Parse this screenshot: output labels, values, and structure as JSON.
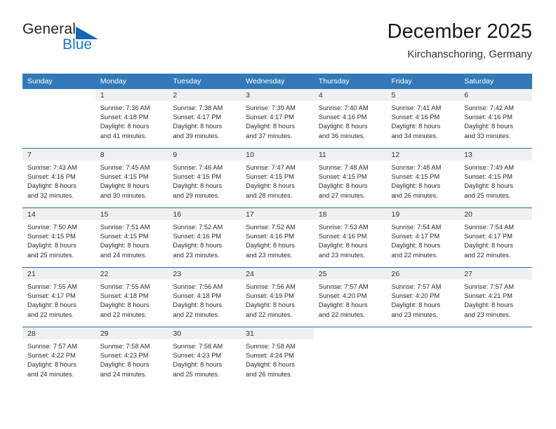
{
  "brand": {
    "name_part1": "General",
    "name_part2": "Blue",
    "triangle_color": "#1666b0",
    "blue_color": "#1779ce"
  },
  "header": {
    "title": "December 2025",
    "subtitle": "Kirchanschoring, Germany"
  },
  "theme": {
    "header_bg": "#3379b8",
    "daynum_band": "#f0f0f0",
    "row_divider": "#2c6aa8"
  },
  "weekday_headers": [
    "Sunday",
    "Monday",
    "Tuesday",
    "Wednesday",
    "Thursday",
    "Friday",
    "Saturday"
  ],
  "weeks": [
    [
      {
        "day": "",
        "lines": [
          "",
          "",
          "",
          ""
        ]
      },
      {
        "day": "1",
        "lines": [
          "Sunrise: 7:36 AM",
          "Sunset: 4:18 PM",
          "Daylight: 8 hours",
          "and 41 minutes."
        ]
      },
      {
        "day": "2",
        "lines": [
          "Sunrise: 7:38 AM",
          "Sunset: 4:17 PM",
          "Daylight: 8 hours",
          "and 39 minutes."
        ]
      },
      {
        "day": "3",
        "lines": [
          "Sunrise: 7:39 AM",
          "Sunset: 4:17 PM",
          "Daylight: 8 hours",
          "and 37 minutes."
        ]
      },
      {
        "day": "4",
        "lines": [
          "Sunrise: 7:40 AM",
          "Sunset: 4:16 PM",
          "Daylight: 8 hours",
          "and 36 minutes."
        ]
      },
      {
        "day": "5",
        "lines": [
          "Sunrise: 7:41 AM",
          "Sunset: 4:16 PM",
          "Daylight: 8 hours",
          "and 34 minutes."
        ]
      },
      {
        "day": "6",
        "lines": [
          "Sunrise: 7:42 AM",
          "Sunset: 4:16 PM",
          "Daylight: 8 hours",
          "and 33 minutes."
        ]
      }
    ],
    [
      {
        "day": "7",
        "lines": [
          "Sunrise: 7:43 AM",
          "Sunset: 4:16 PM",
          "Daylight: 8 hours",
          "and 32 minutes."
        ]
      },
      {
        "day": "8",
        "lines": [
          "Sunrise: 7:45 AM",
          "Sunset: 4:15 PM",
          "Daylight: 8 hours",
          "and 30 minutes."
        ]
      },
      {
        "day": "9",
        "lines": [
          "Sunrise: 7:46 AM",
          "Sunset: 4:15 PM",
          "Daylight: 8 hours",
          "and 29 minutes."
        ]
      },
      {
        "day": "10",
        "lines": [
          "Sunrise: 7:47 AM",
          "Sunset: 4:15 PM",
          "Daylight: 8 hours",
          "and 28 minutes."
        ]
      },
      {
        "day": "11",
        "lines": [
          "Sunrise: 7:48 AM",
          "Sunset: 4:15 PM",
          "Daylight: 8 hours",
          "and 27 minutes."
        ]
      },
      {
        "day": "12",
        "lines": [
          "Sunrise: 7:48 AM",
          "Sunset: 4:15 PM",
          "Daylight: 8 hours",
          "and 26 minutes."
        ]
      },
      {
        "day": "13",
        "lines": [
          "Sunrise: 7:49 AM",
          "Sunset: 4:15 PM",
          "Daylight: 8 hours",
          "and 25 minutes."
        ]
      }
    ],
    [
      {
        "day": "14",
        "lines": [
          "Sunrise: 7:50 AM",
          "Sunset: 4:15 PM",
          "Daylight: 8 hours",
          "and 25 minutes."
        ]
      },
      {
        "day": "15",
        "lines": [
          "Sunrise: 7:51 AM",
          "Sunset: 4:15 PM",
          "Daylight: 8 hours",
          "and 24 minutes."
        ]
      },
      {
        "day": "16",
        "lines": [
          "Sunrise: 7:52 AM",
          "Sunset: 4:16 PM",
          "Daylight: 8 hours",
          "and 23 minutes."
        ]
      },
      {
        "day": "17",
        "lines": [
          "Sunrise: 7:52 AM",
          "Sunset: 4:16 PM",
          "Daylight: 8 hours",
          "and 23 minutes."
        ]
      },
      {
        "day": "18",
        "lines": [
          "Sunrise: 7:53 AM",
          "Sunset: 4:16 PM",
          "Daylight: 8 hours",
          "and 23 minutes."
        ]
      },
      {
        "day": "19",
        "lines": [
          "Sunrise: 7:54 AM",
          "Sunset: 4:17 PM",
          "Daylight: 8 hours",
          "and 22 minutes."
        ]
      },
      {
        "day": "20",
        "lines": [
          "Sunrise: 7:54 AM",
          "Sunset: 4:17 PM",
          "Daylight: 8 hours",
          "and 22 minutes."
        ]
      }
    ],
    [
      {
        "day": "21",
        "lines": [
          "Sunrise: 7:55 AM",
          "Sunset: 4:17 PM",
          "Daylight: 8 hours",
          "and 22 minutes."
        ]
      },
      {
        "day": "22",
        "lines": [
          "Sunrise: 7:55 AM",
          "Sunset: 4:18 PM",
          "Daylight: 8 hours",
          "and 22 minutes."
        ]
      },
      {
        "day": "23",
        "lines": [
          "Sunrise: 7:56 AM",
          "Sunset: 4:18 PM",
          "Daylight: 8 hours",
          "and 22 minutes."
        ]
      },
      {
        "day": "24",
        "lines": [
          "Sunrise: 7:56 AM",
          "Sunset: 4:19 PM",
          "Daylight: 8 hours",
          "and 22 minutes."
        ]
      },
      {
        "day": "25",
        "lines": [
          "Sunrise: 7:57 AM",
          "Sunset: 4:20 PM",
          "Daylight: 8 hours",
          "and 22 minutes."
        ]
      },
      {
        "day": "26",
        "lines": [
          "Sunrise: 7:57 AM",
          "Sunset: 4:20 PM",
          "Daylight: 8 hours",
          "and 23 minutes."
        ]
      },
      {
        "day": "27",
        "lines": [
          "Sunrise: 7:57 AM",
          "Sunset: 4:21 PM",
          "Daylight: 8 hours",
          "and 23 minutes."
        ]
      }
    ],
    [
      {
        "day": "28",
        "lines": [
          "Sunrise: 7:57 AM",
          "Sunset: 4:22 PM",
          "Daylight: 8 hours",
          "and 24 minutes."
        ]
      },
      {
        "day": "29",
        "lines": [
          "Sunrise: 7:58 AM",
          "Sunset: 4:23 PM",
          "Daylight: 8 hours",
          "and 24 minutes."
        ]
      },
      {
        "day": "30",
        "lines": [
          "Sunrise: 7:58 AM",
          "Sunset: 4:23 PM",
          "Daylight: 8 hours",
          "and 25 minutes."
        ]
      },
      {
        "day": "31",
        "lines": [
          "Sunrise: 7:58 AM",
          "Sunset: 4:24 PM",
          "Daylight: 8 hours",
          "and 26 minutes."
        ]
      },
      {
        "day": "",
        "lines": [
          "",
          "",
          "",
          ""
        ]
      },
      {
        "day": "",
        "lines": [
          "",
          "",
          "",
          ""
        ]
      },
      {
        "day": "",
        "lines": [
          "",
          "",
          "",
          ""
        ]
      }
    ]
  ]
}
